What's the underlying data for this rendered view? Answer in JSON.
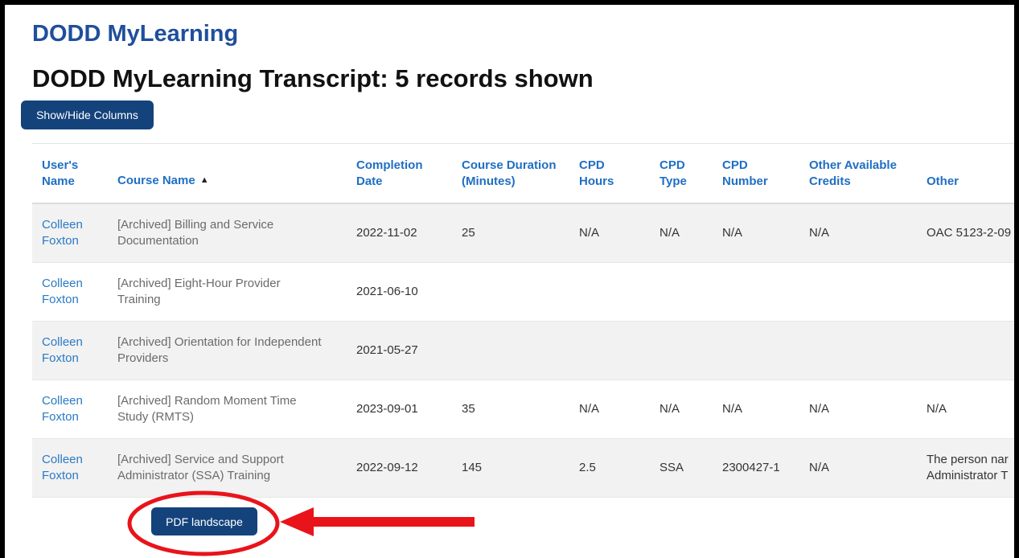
{
  "app_title": "DODD MyLearning",
  "page_title": "DODD MyLearning Transcript: 5 records shown",
  "buttons": {
    "show_hide_columns": "Show/Hide Columns",
    "pdf_landscape": "PDF landscape"
  },
  "table": {
    "headers": {
      "users_name_l1": "User's",
      "users_name_l2": "Name",
      "course_name": "Course Name",
      "completion_date_l1": "Completion",
      "completion_date_l2": "Date",
      "course_duration_l1": "Course Duration",
      "course_duration_l2": "(Minutes)",
      "cpd_hours_l1": "CPD",
      "cpd_hours_l2": "Hours",
      "cpd_type_l1": "CPD",
      "cpd_type_l2": "Type",
      "cpd_number_l1": "CPD",
      "cpd_number_l2": "Number",
      "other_credits_l1": "Other Available",
      "other_credits_l2": "Credits",
      "other": "Other"
    },
    "sort_indicator": "ascending",
    "rows": [
      {
        "first": "Colleen",
        "last": "Foxton",
        "course_l1": "[Archived] Billing and Service",
        "course_l2": "Documentation",
        "date": "2022-11-02",
        "duration": "25",
        "cpd_hours": "N/A",
        "cpd_type": "N/A",
        "cpd_number": "N/A",
        "other_credits": "N/A",
        "other_l1": "OAC 5123-2-09",
        "other_l2": ""
      },
      {
        "first": "Colleen",
        "last": "Foxton",
        "course_l1": "[Archived] Eight-Hour Provider",
        "course_l2": "Training",
        "date": "2021-06-10",
        "duration": "",
        "cpd_hours": "",
        "cpd_type": "",
        "cpd_number": "",
        "other_credits": "",
        "other_l1": "",
        "other_l2": ""
      },
      {
        "first": "Colleen",
        "last": "Foxton",
        "course_l1": "[Archived] Orientation for Independent",
        "course_l2": "Providers",
        "date": "2021-05-27",
        "duration": "",
        "cpd_hours": "",
        "cpd_type": "",
        "cpd_number": "",
        "other_credits": "",
        "other_l1": "",
        "other_l2": ""
      },
      {
        "first": "Colleen",
        "last": "Foxton",
        "course_l1": "[Archived] Random Moment Time",
        "course_l2": "Study (RMTS)",
        "date": "2023-09-01",
        "duration": "35",
        "cpd_hours": "N/A",
        "cpd_type": "N/A",
        "cpd_number": "N/A",
        "other_credits": "N/A",
        "other_l1": "N/A",
        "other_l2": ""
      },
      {
        "first": "Colleen",
        "last": "Foxton",
        "course_l1": "[Archived] Service and Support",
        "course_l2": "Administrator (SSA) Training",
        "date": "2022-09-12",
        "duration": "145",
        "cpd_hours": "2.5",
        "cpd_type": "SSA",
        "cpd_number": "2300427-1",
        "other_credits": "N/A",
        "other_l1": "The person nar",
        "other_l2": "Administrator T"
      }
    ]
  },
  "colors": {
    "app_title": "#1f4f9c",
    "header_link": "#1f6fc4",
    "button_bg": "#14437c",
    "annotation_red": "#e8141a",
    "frame_border": "#000000"
  },
  "icons": {
    "sort": "caret-up-icon"
  }
}
